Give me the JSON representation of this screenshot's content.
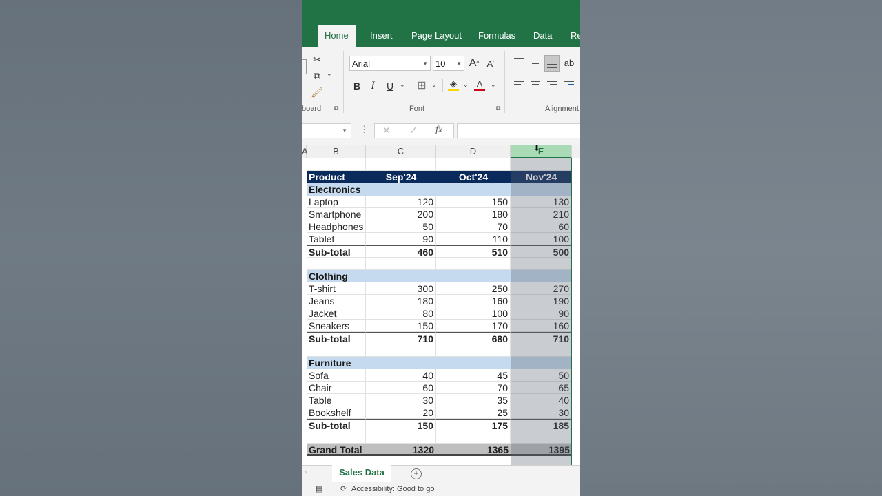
{
  "ribbon": {
    "tabs": [
      {
        "label": "Home",
        "active": true
      },
      {
        "label": "Insert"
      },
      {
        "label": "Page Layout"
      },
      {
        "label": "Formulas"
      },
      {
        "label": "Data"
      },
      {
        "label": "Re"
      }
    ],
    "font_name": "Arial",
    "font_size": "10",
    "group_clipboard": "board",
    "group_font": "Font",
    "group_alignment": "Alignment",
    "bold": "B",
    "italic": "I",
    "underline": "U",
    "font_color": "A",
    "grow_font": "A",
    "shrink_font": "A"
  },
  "formula_bar": {
    "name_box": "",
    "fx": "fx",
    "content": ""
  },
  "columns": [
    "B",
    "C",
    "D",
    "E"
  ],
  "table": {
    "header": [
      "Product",
      "Sep'24",
      "Oct'24",
      "Nov'24"
    ],
    "categories": [
      {
        "name": "Electronics",
        "items": [
          [
            "Laptop",
            "120",
            "150",
            "130"
          ],
          [
            "Smartphone",
            "200",
            "180",
            "210"
          ],
          [
            "Headphones",
            "50",
            "70",
            "60"
          ],
          [
            "Tablet",
            "90",
            "110",
            "100"
          ]
        ],
        "subtotal": [
          "Sub-total",
          "460",
          "510",
          "500"
        ]
      },
      {
        "name": "Clothing",
        "items": [
          [
            "T-shirt",
            "300",
            "250",
            "270"
          ],
          [
            "Jeans",
            "180",
            "160",
            "190"
          ],
          [
            "Jacket",
            "80",
            "100",
            "90"
          ],
          [
            "Sneakers",
            "150",
            "170",
            "160"
          ]
        ],
        "subtotal": [
          "Sub-total",
          "710",
          "680",
          "710"
        ]
      },
      {
        "name": "Furniture",
        "items": [
          [
            "Sofa",
            "40",
            "45",
            "50"
          ],
          [
            "Chair",
            "60",
            "70",
            "65"
          ],
          [
            "Table",
            "30",
            "35",
            "40"
          ],
          [
            "Bookshelf",
            "20",
            "25",
            "30"
          ]
        ],
        "subtotal": [
          "Sub-total",
          "150",
          "175",
          "185"
        ]
      }
    ],
    "grand_total": [
      "Grand Total",
      "1320",
      "1365",
      "1395"
    ]
  },
  "sheet": {
    "active_tab": "Sales Data",
    "add_label": "+"
  },
  "status": {
    "accessibility": "Accessibility: Good to go"
  },
  "colors": {
    "excel_green": "#217346",
    "header_navy": "#0b2a5c",
    "category_blue": "#c5daef",
    "grand_total_gray": "#bfbfbf"
  }
}
